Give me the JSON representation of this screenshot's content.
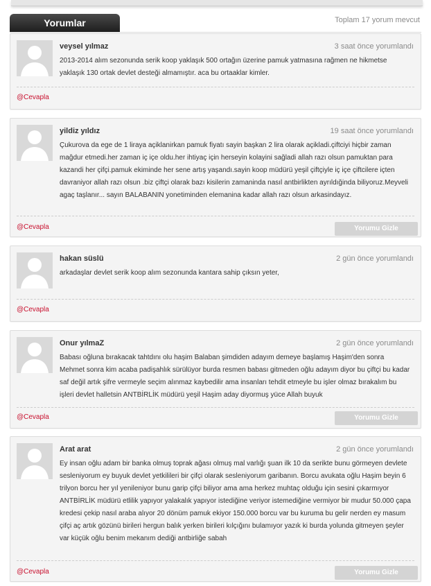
{
  "header": {
    "title": "Yorumlar",
    "total": "Toplam 17 yorum mevcut"
  },
  "comments": [
    {
      "name": "veysel yılmaz",
      "time": "3 saat önce yorumlandı",
      "text": "2013-2014 alım sezonunda serik koop yaklaşık 500 ortağın üzerine pamuk yatmasına rağmen ne hikmetse yaklaşık 130 ortak devlet desteği almamıştır. aca bu ortaaklar kimler.",
      "reply": "@Cevapla"
    },
    {
      "name": "yildiz yıldız",
      "time": "19 saat önce yorumlandı",
      "text": "Çukurova da ege de 1 liraya açiklanirkan pamuk fiyatı sayin başkan 2 lira olarak açikladi.çiftciyi hiçbir zaman mağdur etmedi.her zaman iç içe oldu.her ihtiyaç için herseyin kolayini sağladi allah razı olsun pamuktan para kazandi her çifçi.pamuk ekiminde her sene artış yaşandı.sayin koop müdürü yeşil çiftçiyle iç içe çiftcilere içten davraniyor allah razı olsun .biz çiftçi olarak bazı kisilerin zamaninda nasıl antbirlikten ayrıldığinda biliyoruz.Meyveli agaç taşlanır... sayın BALABANIN yonetiminden elemanina kadar allah razı olsun arkasindayız.",
      "reply": "@Cevapla",
      "hide": "Yorumu Gizle"
    },
    {
      "name": "hakan süslü",
      "time": "2 gün önce yorumlandı",
      "text": "arkadaşlar devlet serik koop alım sezonunda kantara sahip çıksın yeter,",
      "reply": "@Cevapla"
    },
    {
      "name": "Onur yılmaZ",
      "time": "2 gün önce yorumlandı",
      "text": "Babası oğluna bırakacak tahtdını olu haşim Balaban şimdiden adayım demeye başlamış Haşim'den sonra Mehmet sonra kim acaba padişahlık sürülüyor burda resmen babası gitmeden oğlu adayım diyor bu çiftçi bu kadar saf değil artık şifre vermeyle seçim alınmaz kaybedilir ama insanları tehdit etmeyle bu işler olmaz bırakalım bu işleri devlet halletsin ANTBİRLİK müdürü yeşil Haşim aday diyormuş yüce Allah buyuk",
      "reply": "@Cevapla",
      "hide": "Yorumu Gizle"
    },
    {
      "name": "Arat arat",
      "time": "2 gün önce yorumlandı",
      "text": "Ey insan oğlu adam bir banka olmuş toprak ağası olmuş mal varlığı şuan ilk 10 da serikte bunu görmeyen devlete sesleniyorum ey buyuk devlet yetkilileri bir çifçi olarak sesleniyorum garibanın. Borcu avukata oğlu Haşim beyin 6 trilyon borcu her yıl yenileniyor bunu garip çifçi biliyor ama ama herkez muhtaç olduğu için sesini çıkarmıyor ANTBİRLİK müdürü etlilik yapıyor yalakalık yapıyor istediğine veriyor istemediğine vermiyor bir mudur 50.000 çapa kredesi çekip nasıl araba alıyor 20 dönüm pamuk ekiyor 150.000 borcu var bu kuruma bu gelir nerden ey masum çifçi aç artık gözünü birileri hergun balık yerken birileri kılçığını bulamıyor yazık ki burda yolunda gitmeyen şeyler var küçük oğlu benim mekanım dediği antbirliğe sabah",
      "reply": "@Cevapla",
      "hide": "Yorumu Gizle"
    }
  ]
}
